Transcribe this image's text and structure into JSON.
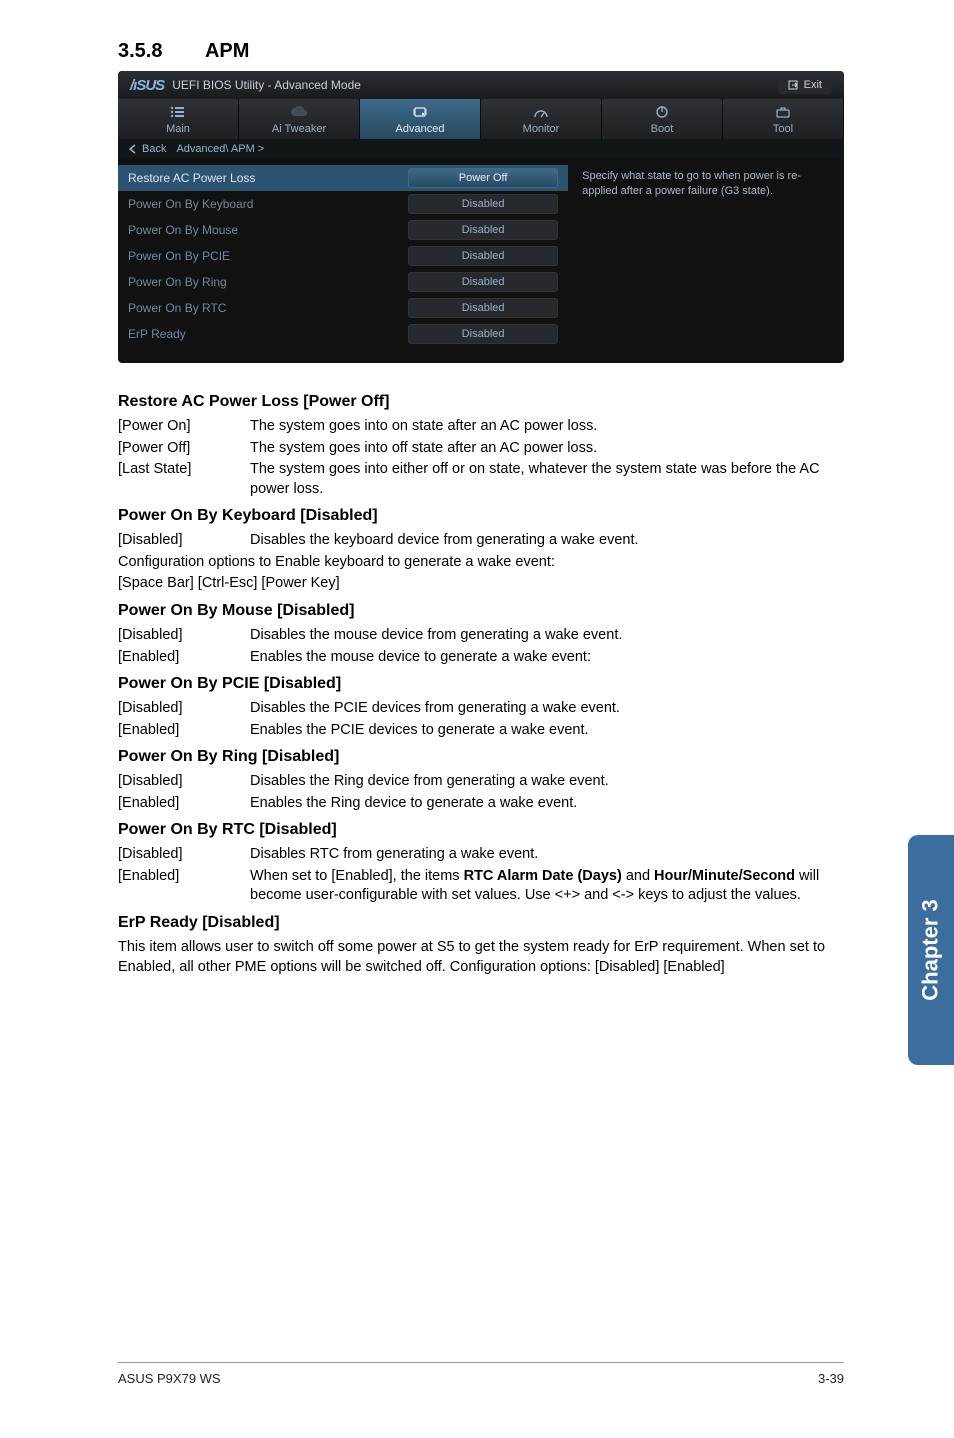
{
  "section": {
    "number": "3.5.8",
    "title": "APM"
  },
  "bios": {
    "header_title": "UEFI BIOS Utility - Advanced Mode",
    "logo": "/ıSUS",
    "exit": "Exit",
    "tabs": {
      "main": "Main",
      "ai_tweaker": "Ai  Tweaker",
      "advanced": "Advanced",
      "monitor": "Monitor",
      "boot": "Boot",
      "tool": "Tool"
    },
    "back": "Back",
    "breadcrumb": "Advanced\\ APM >",
    "rows": [
      {
        "label": "Restore AC Power Loss",
        "value": "Power Off",
        "selected": true
      },
      {
        "label": "Power On By Keyboard",
        "value": "Disabled",
        "selected": false
      },
      {
        "label": "Power On By Mouse",
        "value": "Disabled",
        "selected": false
      },
      {
        "label": "Power On By PCIE",
        "value": "Disabled",
        "selected": false
      },
      {
        "label": "Power On By Ring",
        "value": "Disabled",
        "selected": false
      },
      {
        "label": "Power On By RTC",
        "value": "Disabled",
        "selected": false
      },
      {
        "label": "ErP Ready",
        "value": "Disabled",
        "selected": false
      }
    ],
    "help": "Specify what state to go to when power is re-applied after a power failure (G3 state)."
  },
  "restore": {
    "heading": "Restore AC Power Loss [Power Off]",
    "r1k": "[Power On]",
    "r1v": "The system goes into on state after an AC power loss.",
    "r2k": "[Power Off]",
    "r2v": "The system goes into off state after an AC power loss.",
    "r3k": "[Last State]",
    "r3v": "The system goes into either off or on state, whatever the system state was before the AC power loss."
  },
  "keyboard": {
    "heading": "Power On By Keyboard [Disabled]",
    "r1k": "[Disabled]",
    "r1v": "Disables the keyboard device from generating a wake event.",
    "l2": "Configuration options to Enable keyboard to generate a wake event:",
    "l3": "[Space Bar] [Ctrl-Esc] [Power Key]"
  },
  "mouse": {
    "heading": "Power On By Mouse [Disabled]",
    "r1k": "[Disabled]",
    "r1v": "Disables the mouse device from generating a wake event.",
    "r2k": "[Enabled]",
    "r2v": "Enables the mouse device to generate a wake event:"
  },
  "pcie": {
    "heading": "Power On By PCIE [Disabled]",
    "r1k": "[Disabled]",
    "r1v": "Disables the PCIE devices from generating a wake event.",
    "r2k": "[Enabled]",
    "r2v": "Enables the PCIE devices to generate a wake event."
  },
  "ring": {
    "heading": "Power On By Ring [Disabled]",
    "r1k": "[Disabled]",
    "r1v": "Disables the Ring device from generating a wake event.",
    "r2k": "[Enabled]",
    "r2v": "Enables the Ring device to generate a wake event."
  },
  "rtc": {
    "heading": "Power On By RTC [Disabled]",
    "r1k": "[Disabled]",
    "r1v": "Disables RTC from generating a wake event.",
    "r2k": "[Enabled]",
    "r2v_a": "When set to [Enabled], the items ",
    "r2v_b": "RTC Alarm Date (Days)",
    "r2v_c": " and ",
    "r2v_d": "Hour/Minute/Second",
    "r2v_e": " will become user-configurable with set values. Use <+> and <-> keys to adjust the values."
  },
  "erp": {
    "heading": "ErP Ready [Disabled]",
    "body": "This item allows user to switch off some power at S5 to get the system ready for ErP requirement. When set to Enabled, all other PME options will be switched off. Configuration options: [Disabled] [Enabled]"
  },
  "side_tab": "Chapter 3",
  "footer": {
    "left": "ASUS P9X79 WS",
    "right": "3-39"
  }
}
